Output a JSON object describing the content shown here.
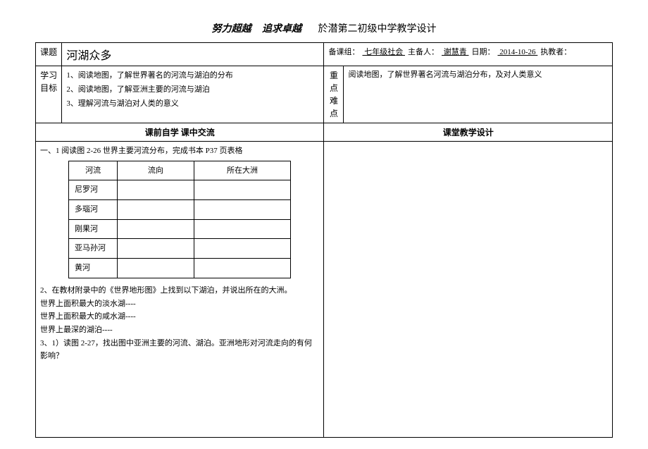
{
  "header": {
    "motto1": "努力超越",
    "motto2": "追求卓越",
    "school": "於潜第二初级中学教学设计"
  },
  "labels": {
    "topic": "课题",
    "goals": "学习目标",
    "keypoints": "重点难点",
    "prestudy": "课前自学  课中交流",
    "classroom": "课堂教学设计"
  },
  "topic": "河湖众多",
  "info": {
    "group_label": "备课组：",
    "group_value": "  七年级社会  ",
    "preparer_label": "主备人：",
    "preparer_value": "  谢慧青  ",
    "date_label": "日期：",
    "date_value": "  2014-10-26  ",
    "teacher_label": "执教者：",
    "teacher_value": "           "
  },
  "goals": {
    "g1": "1、阅读地图，了解世界著名的河流与湖泊的分布",
    "g2": "2、阅读地图，了解亚洲主要的河流与湖泊",
    "g3": "3、理解河流与湖泊对人类的意义"
  },
  "keypoints": "阅读地图，了解世界著名河流与湖泊分布，及对人类意义",
  "content": {
    "task1_intro": "一、1 阅读图 2-26 世界主要河流分布，完成书本 P37 页表格",
    "table_headers": {
      "river": "河流",
      "direction": "流向",
      "continent": "所在大洲"
    },
    "rivers": {
      "r1": "尼罗河",
      "r2": "多瑙河",
      "r3": "刚果河",
      "r4": "亚马孙河",
      "r5": "黄河"
    },
    "task2": "2、在教材附录中的《世界地形图》上找到以下湖泊，并说出所在的大洲。",
    "lake1": "世界上面积最大的淡水湖----",
    "lake2": "世界上面积最大的咸水湖----",
    "lake3": "世界上最深的湖泊----",
    "task3": "3、1）读图 2-27，找出图中亚洲主要的河流、湖泊。亚洲地形对河流走向的有何影响？"
  }
}
